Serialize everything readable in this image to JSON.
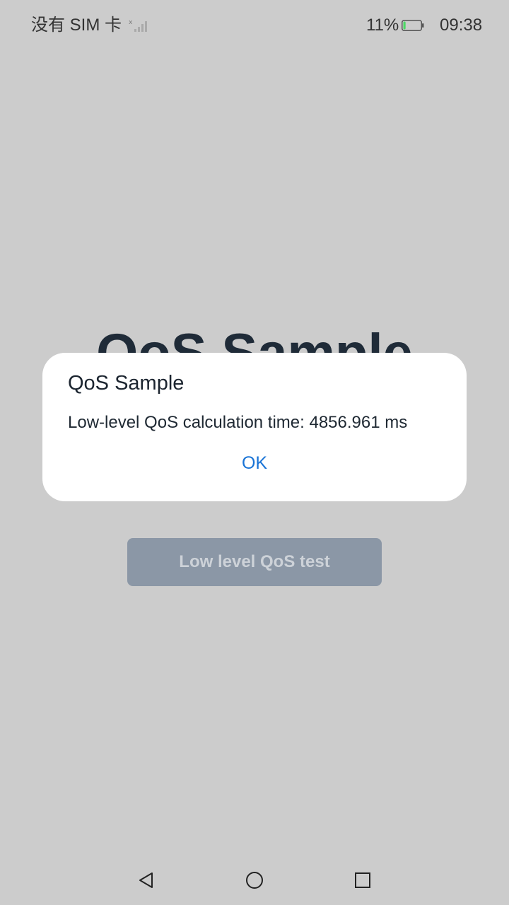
{
  "status_bar": {
    "carrier": "没有 SIM 卡",
    "battery_percent": "11%",
    "battery_level": 0.11,
    "battery_color": "#4cd964",
    "time": "09:38"
  },
  "app": {
    "title": "QoS Sample",
    "button_label": "Low level QoS test"
  },
  "dialog": {
    "title": "QoS Sample",
    "message": "Low-level QoS calculation time: 4856.961 ms",
    "ok_label": "OK",
    "accent_color": "#1a74d6"
  },
  "nav": {
    "back_icon": "back-triangle-icon",
    "home_icon": "home-circle-icon",
    "recent_icon": "recent-square-icon"
  }
}
